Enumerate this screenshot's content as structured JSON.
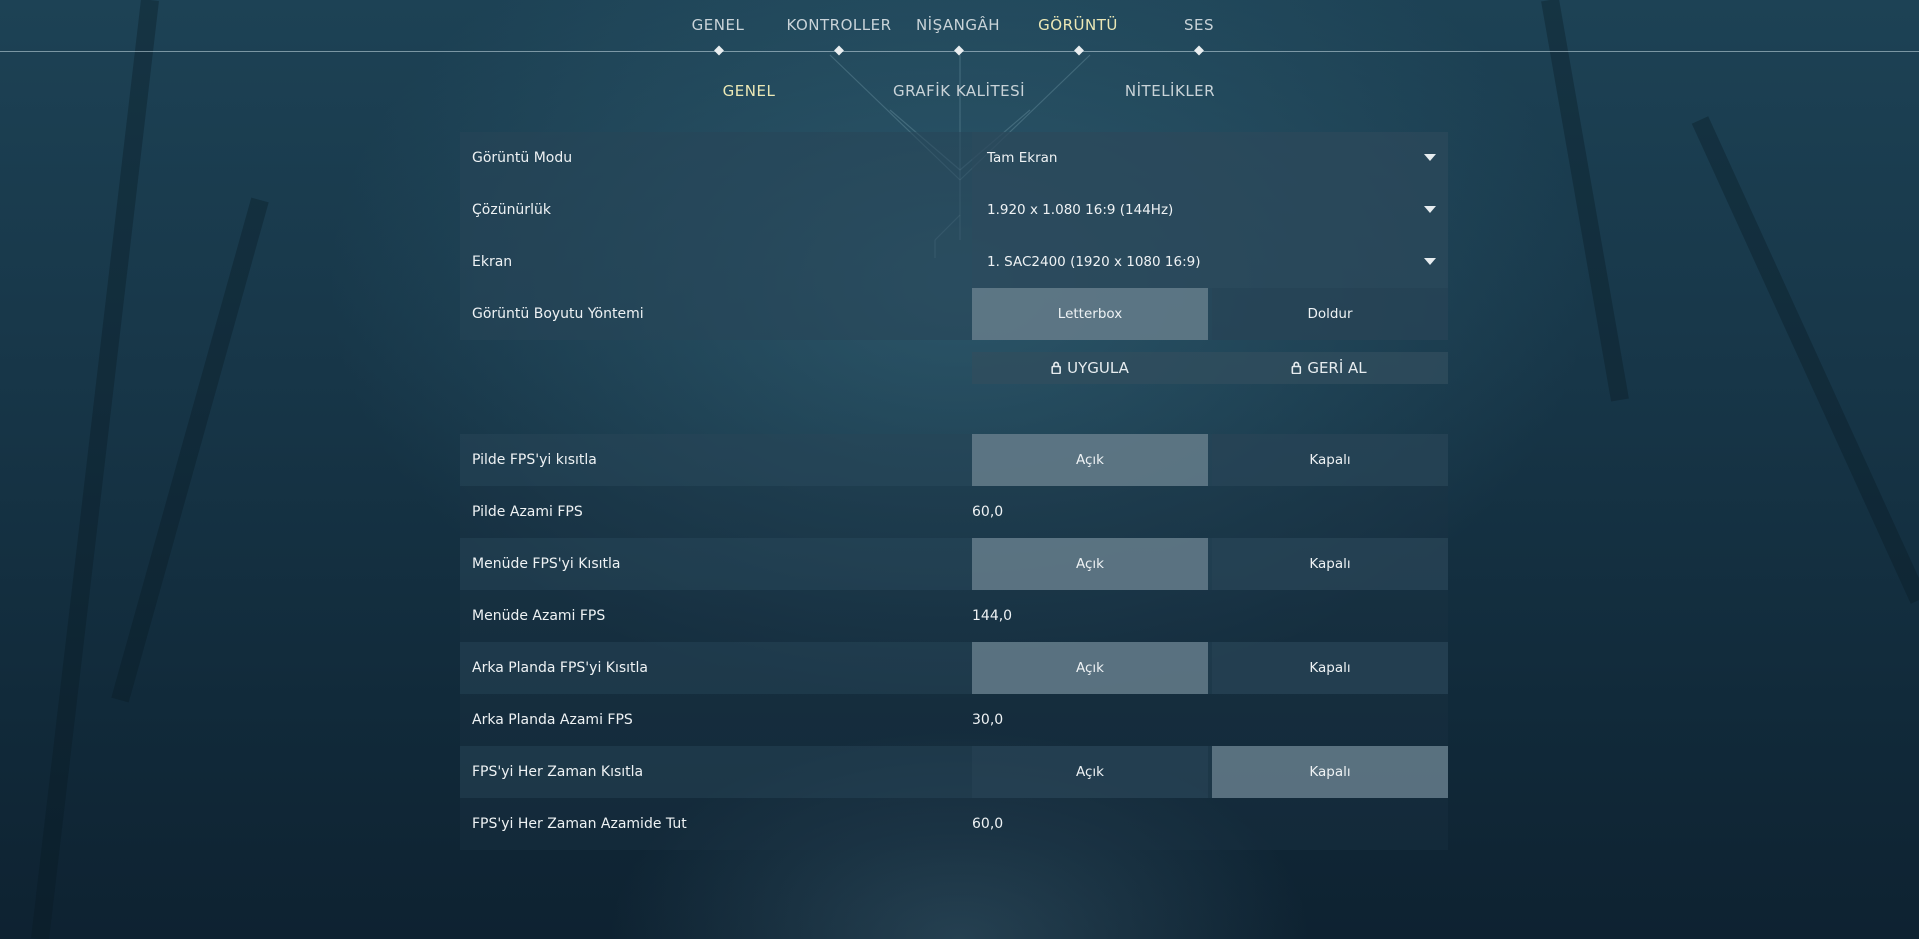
{
  "top_tabs": [
    {
      "label": "GENEL",
      "active": false
    },
    {
      "label": "KONTROLLER",
      "active": false
    },
    {
      "label": "NİŞANGÂH",
      "active": false
    },
    {
      "label": "GÖRÜNTÜ",
      "active": true
    },
    {
      "label": "SES",
      "active": false
    }
  ],
  "sub_tabs": [
    {
      "label": "GENEL",
      "active": true
    },
    {
      "label": "GRAFİK KALİTESİ",
      "active": false
    },
    {
      "label": "NİTELİKLER",
      "active": false
    }
  ],
  "settings": {
    "display_mode": {
      "label": "Görüntü Modu",
      "value": "Tam Ekran"
    },
    "resolution": {
      "label": "Çözünürlük",
      "value": "1.920 x 1.080 16:9 (144Hz)"
    },
    "monitor": {
      "label": "Ekran",
      "value": "1. SAC2400 (1920 x  1080 16:9)"
    },
    "aspect_method": {
      "label": "Görüntü Boyutu Yöntemi",
      "options": [
        "Letterbox",
        "Doldur"
      ],
      "selected": "Letterbox"
    },
    "apply_label": "UYGULA",
    "revert_label": "GERİ AL",
    "limit_fps_battery": {
      "label": "Pilde FPS'yi kısıtla",
      "options": [
        "Açık",
        "Kapalı"
      ],
      "selected": "Açık"
    },
    "max_fps_battery": {
      "label": "Pilde Azami FPS",
      "value": "60,0"
    },
    "limit_fps_menu": {
      "label": "Menüde FPS'yi Kısıtla",
      "options": [
        "Açık",
        "Kapalı"
      ],
      "selected": "Açık"
    },
    "max_fps_menu": {
      "label": "Menüde Azami FPS",
      "value": "144,0"
    },
    "limit_fps_background": {
      "label": "Arka Planda FPS'yi Kısıtla",
      "options": [
        "Açık",
        "Kapalı"
      ],
      "selected": "Açık"
    },
    "max_fps_background": {
      "label": "Arka Planda Azami FPS",
      "value": "30,0"
    },
    "limit_fps_always": {
      "label": "FPS'yi Her Zaman Kısıtla",
      "options": [
        "Açık",
        "Kapalı"
      ],
      "selected": "Kapalı"
    },
    "max_fps_always": {
      "label": "FPS'yi Her Zaman Azamide Tut",
      "value": "60,0"
    }
  },
  "colors": {
    "active_tab": "#ece8b6",
    "selected_toggle": "#6e8492"
  }
}
